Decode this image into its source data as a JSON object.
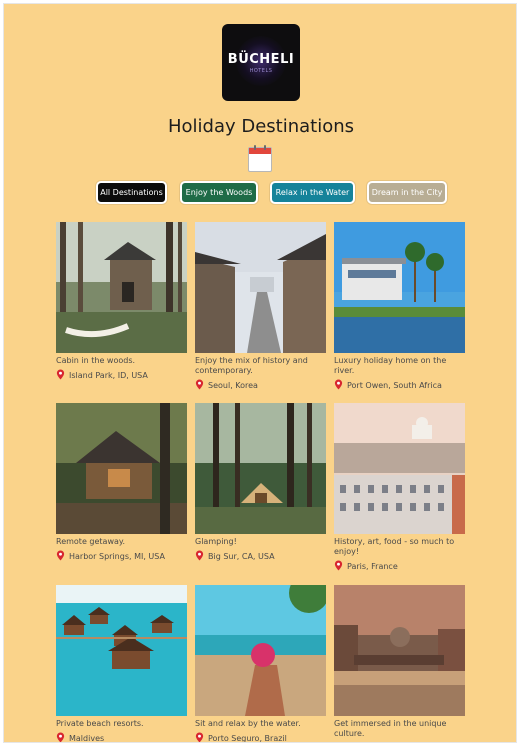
{
  "brand": {
    "logo_text": "BÜCHELI",
    "logo_subtext": "HOTELS"
  },
  "page_title": "Holiday Destinations",
  "filters": [
    {
      "label": "All Destinations",
      "color": "#0c0c0c"
    },
    {
      "label": "Enjoy the Woods",
      "color": "#1e6b47"
    },
    {
      "label": "Relax in the Water",
      "color": "#15839a"
    },
    {
      "label": "Dream in the City",
      "color": "#b8ad94"
    }
  ],
  "destinations": [
    {
      "caption": "Cabin in the woods.",
      "location": "Island Park, ID, USA",
      "image": "cabin-woods-photo"
    },
    {
      "caption": "Enjoy the mix of history and contemporary.",
      "location": "Seoul, Korea",
      "image": "seoul-street-photo"
    },
    {
      "caption": "Luxury holiday home on the river.",
      "location": "Port Owen, South Africa",
      "image": "river-home-photo"
    },
    {
      "caption": "Remote getaway.",
      "location": "Harbor Springs, MI, USA",
      "image": "forest-cabin-photo"
    },
    {
      "caption": "Glamping!",
      "location": "Big Sur, CA, USA",
      "image": "glamping-tent-photo"
    },
    {
      "caption": "History, art, food - so much to enjoy!",
      "location": "Paris, France",
      "image": "paris-city-photo"
    },
    {
      "caption": "Private beach resorts.",
      "location": "Maldives",
      "image": "overwater-bungalows-photo"
    },
    {
      "caption": "Sit and relax by the water.",
      "location": "Porto Seguro, Brazil",
      "image": "beach-drink-photo"
    },
    {
      "caption": "Get immersed in the unique culture.",
      "location": "",
      "image": "venice-canal-photo"
    }
  ],
  "colors": {
    "background": "#fad38a",
    "pin": "#d8262f"
  },
  "icons": {
    "location": "map-pin-icon",
    "calendar": "calendar-icon"
  }
}
